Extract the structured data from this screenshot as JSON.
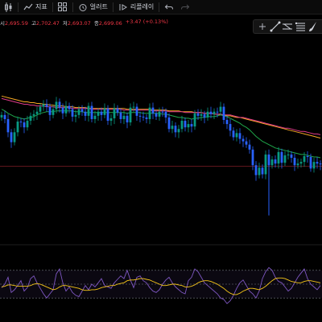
{
  "toolbar": {
    "indicators_label": "지표",
    "alert_label": "얼러트",
    "replay_label": "리플레이"
  },
  "ohlc": {
    "open_label": "시",
    "open": "2,695.59",
    "high_label": "고",
    "high": "2,702.47",
    "low_label": "저",
    "low": "2,693.07",
    "close_label": "종",
    "close": "2,699.06",
    "change": "+3.47 (+0.13%)"
  },
  "drawing_tools": [
    "plus-icon",
    "trend-line-icon",
    "horizontal-ray-icon",
    "fib-retracement-icon",
    "brush-icon"
  ],
  "colors": {
    "background": "#000000",
    "up": "#089981",
    "down": "#2962ff",
    "ma_slow": "#f5a623",
    "ma_mid": "#e03b8b",
    "ma_fast": "#1fa64a",
    "price_line": "#f23645",
    "rsi_line": "#7e57c2",
    "rsi_signal": "#f5c518"
  },
  "chart_data": [
    {
      "type": "candlestick",
      "x": [
        1,
        2,
        3,
        4,
        5,
        6,
        7,
        8,
        9,
        10,
        11,
        12,
        13,
        14,
        15,
        16,
        17,
        18,
        19,
        20,
        21,
        22,
        23,
        24,
        25,
        26,
        27,
        28,
        29,
        30,
        31,
        32,
        33,
        34,
        35,
        36,
        37,
        38,
        39,
        40,
        41,
        42,
        43,
        44,
        45,
        46,
        47,
        48,
        49,
        50,
        51,
        52,
        53,
        54,
        55,
        56,
        57,
        58,
        59,
        60,
        61,
        62,
        63,
        64,
        65,
        66,
        67,
        68,
        69,
        70,
        71,
        72,
        73,
        74,
        75,
        76,
        77,
        78,
        79,
        80,
        81,
        82,
        83,
        84,
        85,
        86,
        87,
        88,
        89,
        90,
        91,
        92,
        93,
        94,
        95,
        96,
        97,
        98,
        99,
        100
      ],
      "close": [
        141,
        146,
        162,
        174,
        162,
        149,
        150,
        156,
        148,
        142,
        140,
        137,
        131,
        128,
        131,
        141,
        134,
        125,
        132,
        139,
        130,
        134,
        143,
        141,
        134,
        137,
        142,
        130,
        146,
        142,
        137,
        141,
        133,
        148,
        145,
        133,
        138,
        146,
        142,
        150,
        132,
        131,
        142,
        143,
        144,
        146,
        132,
        139,
        143,
        137,
        137,
        144,
        158,
        154,
        162,
        158,
        148,
        156,
        152,
        155,
        139,
        142,
        140,
        144,
        137,
        140,
        137,
        137,
        131,
        147,
        152,
        160,
        168,
        163,
        170,
        173,
        177,
        183,
        202,
        214,
        205,
        213,
        189,
        202,
        195,
        200,
        186,
        199,
        190,
        189,
        193,
        202,
        200,
        198,
        191,
        192,
        206,
        198,
        200,
        201
      ],
      "open_ref": "first value is first visible bar",
      "series": [
        {
          "name": "",
          "color_key": "ma_slow",
          "values": [
            118,
            119,
            120,
            121,
            122,
            123,
            124,
            125,
            125,
            126,
            126,
            127,
            127,
            128,
            128,
            129,
            129,
            130,
            130,
            130,
            131,
            131,
            131,
            132,
            132,
            132,
            132,
            133,
            133,
            133,
            133,
            133,
            133,
            133,
            133,
            133,
            133,
            133,
            133,
            134,
            134,
            134,
            134,
            134,
            134,
            134,
            134,
            135,
            135,
            135,
            135,
            135,
            136,
            136,
            136,
            136,
            137,
            137,
            137,
            137,
            138,
            138,
            138,
            139,
            139,
            139,
            140,
            140,
            141,
            141,
            142,
            142,
            143,
            144,
            144,
            145,
            146,
            147,
            148,
            149,
            150,
            151,
            152,
            153,
            154,
            155,
            156,
            157,
            158,
            159,
            160,
            161,
            162,
            163,
            164,
            165,
            166,
            167,
            168,
            169
          ]
        },
        {
          "name": "",
          "color_key": "ma_mid",
          "values": [
            121,
            122,
            123,
            124,
            125,
            126,
            127,
            128,
            128,
            129,
            129,
            130,
            130,
            130,
            131,
            131,
            131,
            132,
            132,
            132,
            132,
            132,
            133,
            133,
            133,
            133,
            133,
            133,
            134,
            134,
            134,
            134,
            134,
            134,
            134,
            134,
            134,
            134,
            135,
            135,
            135,
            135,
            135,
            135,
            135,
            135,
            135,
            136,
            136,
            136,
            136,
            136,
            137,
            137,
            137,
            137,
            137,
            138,
            138,
            138,
            138,
            138,
            138,
            139,
            139,
            139,
            140,
            140,
            140,
            141,
            141,
            141,
            142,
            143,
            144,
            144,
            145,
            146,
            147,
            148,
            149,
            150,
            151,
            152,
            153,
            154,
            155,
            156,
            157,
            157,
            158,
            159,
            160,
            161,
            161,
            162,
            163,
            164,
            164,
            165
          ]
        },
        {
          "name": "",
          "color_key": "ma_fast",
          "values": [
            134,
            136,
            139,
            141,
            143,
            144,
            145,
            146,
            145,
            144,
            143,
            141,
            139,
            138,
            137,
            137,
            137,
            136,
            136,
            136,
            136,
            136,
            136,
            137,
            137,
            137,
            138,
            138,
            138,
            138,
            138,
            138,
            138,
            138,
            138,
            138,
            138,
            138,
            138,
            139,
            138,
            138,
            138,
            138,
            139,
            139,
            139,
            139,
            139,
            139,
            140,
            140,
            141,
            142,
            143,
            144,
            144,
            145,
            145,
            146,
            145,
            145,
            144,
            144,
            143,
            143,
            143,
            142,
            141,
            142,
            143,
            145,
            147,
            149,
            151,
            154,
            156,
            159,
            163,
            167,
            170,
            173,
            175,
            177,
            179,
            181,
            182,
            183,
            184,
            185,
            186,
            187,
            188,
            189,
            189,
            190,
            191,
            192,
            192,
            193
          ]
        }
      ],
      "ylim": [
        280,
        60
      ],
      "price_line": 203
    },
    {
      "type": "line",
      "name": "",
      "ylim": [
        0,
        100
      ],
      "bands": [
        70,
        50,
        30
      ],
      "series": [
        {
          "name": "",
          "color_key": "rsi_line",
          "values": [
            45,
            50,
            60,
            38,
            42,
            48,
            55,
            40,
            45,
            58,
            62,
            52,
            44,
            36,
            30,
            36,
            42,
            65,
            72,
            52,
            40,
            46,
            38,
            34,
            32,
            40,
            48,
            42,
            50,
            46,
            52,
            58,
            48,
            46,
            44,
            52,
            57,
            62,
            58,
            70,
            56,
            45,
            60,
            62,
            55,
            52,
            45,
            40,
            38,
            42,
            50,
            56,
            60,
            52,
            46,
            42,
            38,
            36,
            55,
            60,
            72,
            68,
            60,
            52,
            48,
            44,
            40,
            36,
            30,
            28,
            22,
            26,
            34,
            44,
            52,
            56,
            48,
            40,
            36,
            30,
            40,
            58,
            68,
            74,
            70,
            60,
            54,
            52,
            46,
            40,
            44,
            52,
            60,
            66,
            72,
            58,
            50,
            46,
            42,
            48
          ]
        },
        {
          "name": "",
          "color_key": "rsi_signal",
          "values": [
            46,
            47,
            49,
            49,
            48,
            47,
            47,
            47,
            47,
            48,
            50,
            51,
            50,
            48,
            46,
            44,
            42,
            43,
            46,
            48,
            48,
            47,
            46,
            45,
            44,
            42,
            41,
            41,
            42,
            42,
            43,
            45,
            46,
            47,
            48,
            48,
            50,
            51,
            52,
            55,
            56,
            56,
            57,
            58,
            58,
            57,
            56,
            54,
            52,
            50,
            48,
            48,
            49,
            50,
            50,
            49,
            48,
            46,
            46,
            47,
            49,
            52,
            54,
            55,
            55,
            54,
            52,
            50,
            47,
            44,
            40,
            37,
            35,
            35,
            37,
            40,
            42,
            44,
            44,
            43,
            42,
            44,
            47,
            51,
            55,
            58,
            59,
            59,
            58,
            56,
            54,
            53,
            52,
            52,
            54,
            55,
            55,
            54,
            53,
            52
          ]
        }
      ]
    }
  ]
}
